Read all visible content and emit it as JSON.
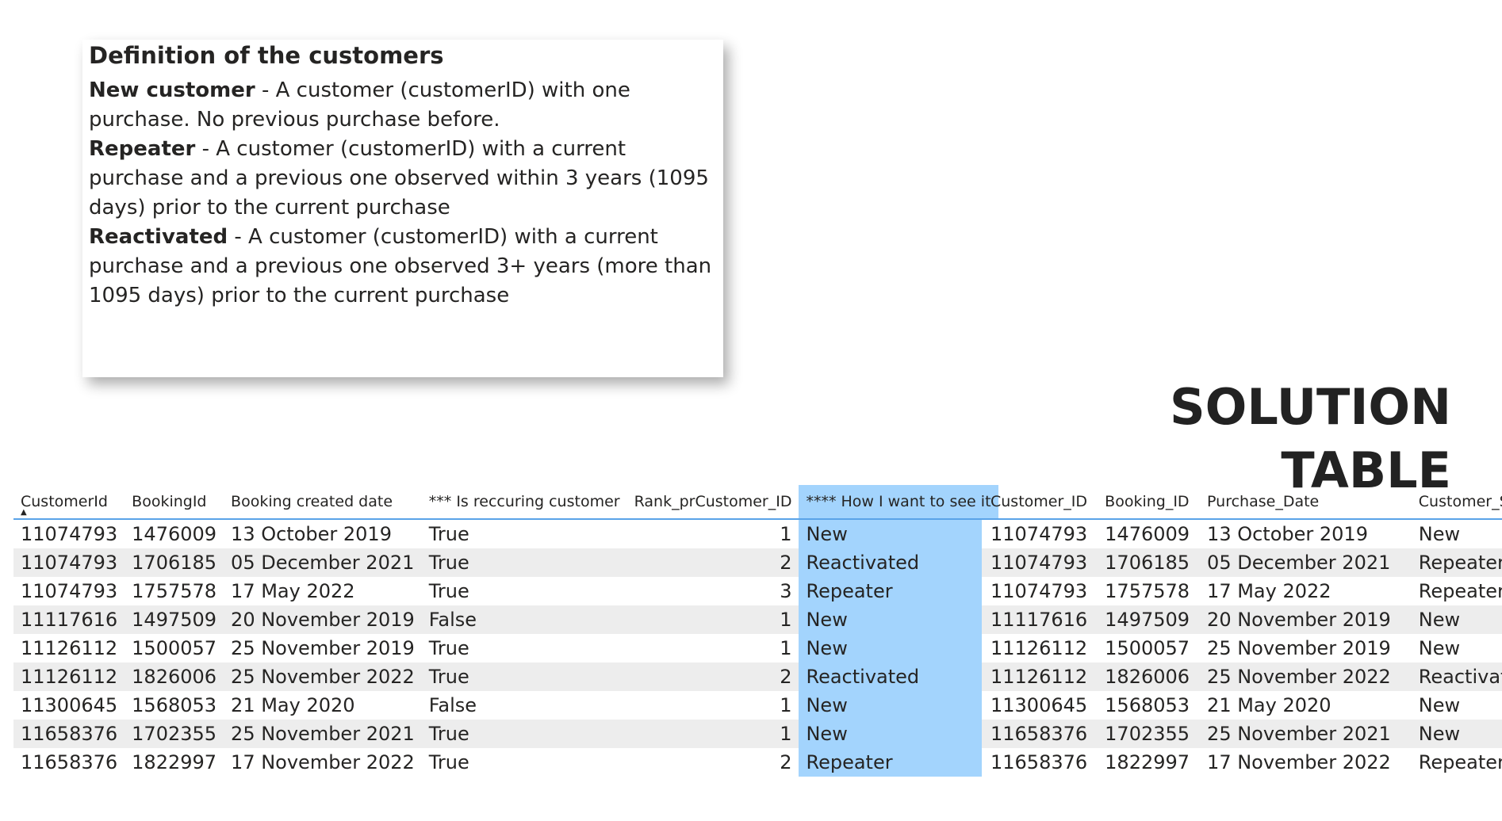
{
  "definitions": {
    "title": "Definition of the customers",
    "items": [
      {
        "term": "New customer",
        "text": " - A customer (customerID) with one purchase. No previous purchase before."
      },
      {
        "term": "Repeater",
        "text": " - A customer (customerID) with a current purchase and a previous one observed within 3 years (1095 days) prior to the current purchase"
      },
      {
        "term": "Reactivated",
        "text": " - A customer (customerID) with a current purchase and a previous one observed 3+ years (more than 1095 days) prior to the current purchase"
      }
    ]
  },
  "solution_title": "SOLUTION TABLE",
  "left_table": {
    "headers": [
      "CustomerId",
      "BookingId",
      "Booking created date",
      "*** Is reccuring customer",
      "Rank_prCustomer_ID",
      "**** How I want to see it"
    ],
    "sort_glyph": "▲",
    "rows": [
      [
        "11074793",
        "1476009",
        "13 October 2019",
        "True",
        "1",
        "New"
      ],
      [
        "11074793",
        "1706185",
        "05 December 2021",
        "True",
        "2",
        "Reactivated"
      ],
      [
        "11074793",
        "1757578",
        "17 May 2022",
        "True",
        "3",
        "Repeater"
      ],
      [
        "11117616",
        "1497509",
        "20 November 2019",
        "False",
        "1",
        "New"
      ],
      [
        "11126112",
        "1500057",
        "25 November 2019",
        "True",
        "1",
        "New"
      ],
      [
        "11126112",
        "1826006",
        "25 November 2022",
        "True",
        "2",
        "Reactivated"
      ],
      [
        "11300645",
        "1568053",
        "21 May 2020",
        "False",
        "1",
        "New"
      ],
      [
        "11658376",
        "1702355",
        "25 November 2021",
        "True",
        "1",
        "New"
      ],
      [
        "11658376",
        "1822997",
        "17 November 2022",
        "True",
        "2",
        "Repeater"
      ]
    ]
  },
  "right_table": {
    "headers": [
      "Customer_ID",
      "Booking_ID",
      "Purchase_Date",
      "Customer_Status"
    ],
    "rows": [
      [
        "11074793",
        "1476009",
        "13 October 2019",
        "New"
      ],
      [
        "11074793",
        "1706185",
        "05 December 2021",
        "Repeater"
      ],
      [
        "11074793",
        "1757578",
        "17 May 2022",
        "Repeater"
      ],
      [
        "11117616",
        "1497509",
        "20 November 2019",
        "New"
      ],
      [
        "11126112",
        "1500057",
        "25 November 2019",
        "New"
      ],
      [
        "11126112",
        "1826006",
        "25 November 2022",
        "Reactivated"
      ],
      [
        "11300645",
        "1568053",
        "21 May 2020",
        "New"
      ],
      [
        "11658376",
        "1702355",
        "25 November 2021",
        "New"
      ],
      [
        "11658376",
        "1822997",
        "17 November 2022",
        "Repeater"
      ]
    ]
  },
  "colors": {
    "highlight_column": "#a3d4fd",
    "header_rule": "#5aa3e8",
    "row_stripe": "#ededed"
  }
}
